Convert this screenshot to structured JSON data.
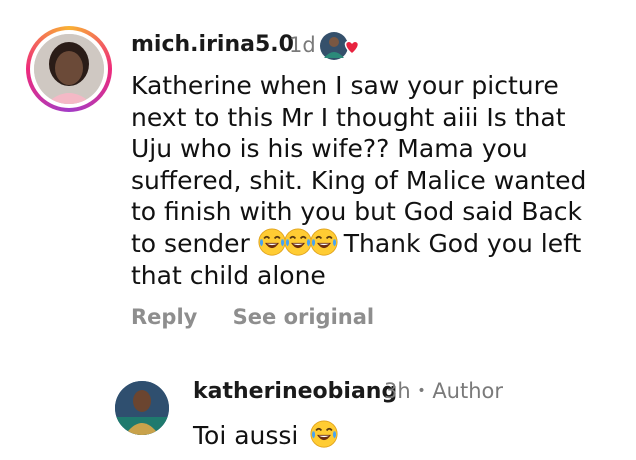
{
  "comment": {
    "username": "mich.irina5.0",
    "time": "1d",
    "text_before_emoji": "Katherine when I saw your picture next to this Mr I thought aiii Is that Uju who is his wife?? Mama you suffered, shit. King of Malice wanted to finish with you but God said Back to sender",
    "text_after_emoji": "Thank God you left that child alone",
    "emoji_name": "tears-of-joy",
    "reply_label": "Reply",
    "see_original_label": "See original"
  },
  "reply": {
    "username": "katherineobiang",
    "time": "3h",
    "separator": "•",
    "role": "Author",
    "text": "Toi aussi",
    "emoji_name": "tears-of-joy"
  },
  "colors": {
    "muted_text": "#8e8e8e",
    "heart": "#e8233f",
    "ring_gradient": [
      "#f9b233",
      "#ee2a7b",
      "#a23cc7"
    ]
  }
}
